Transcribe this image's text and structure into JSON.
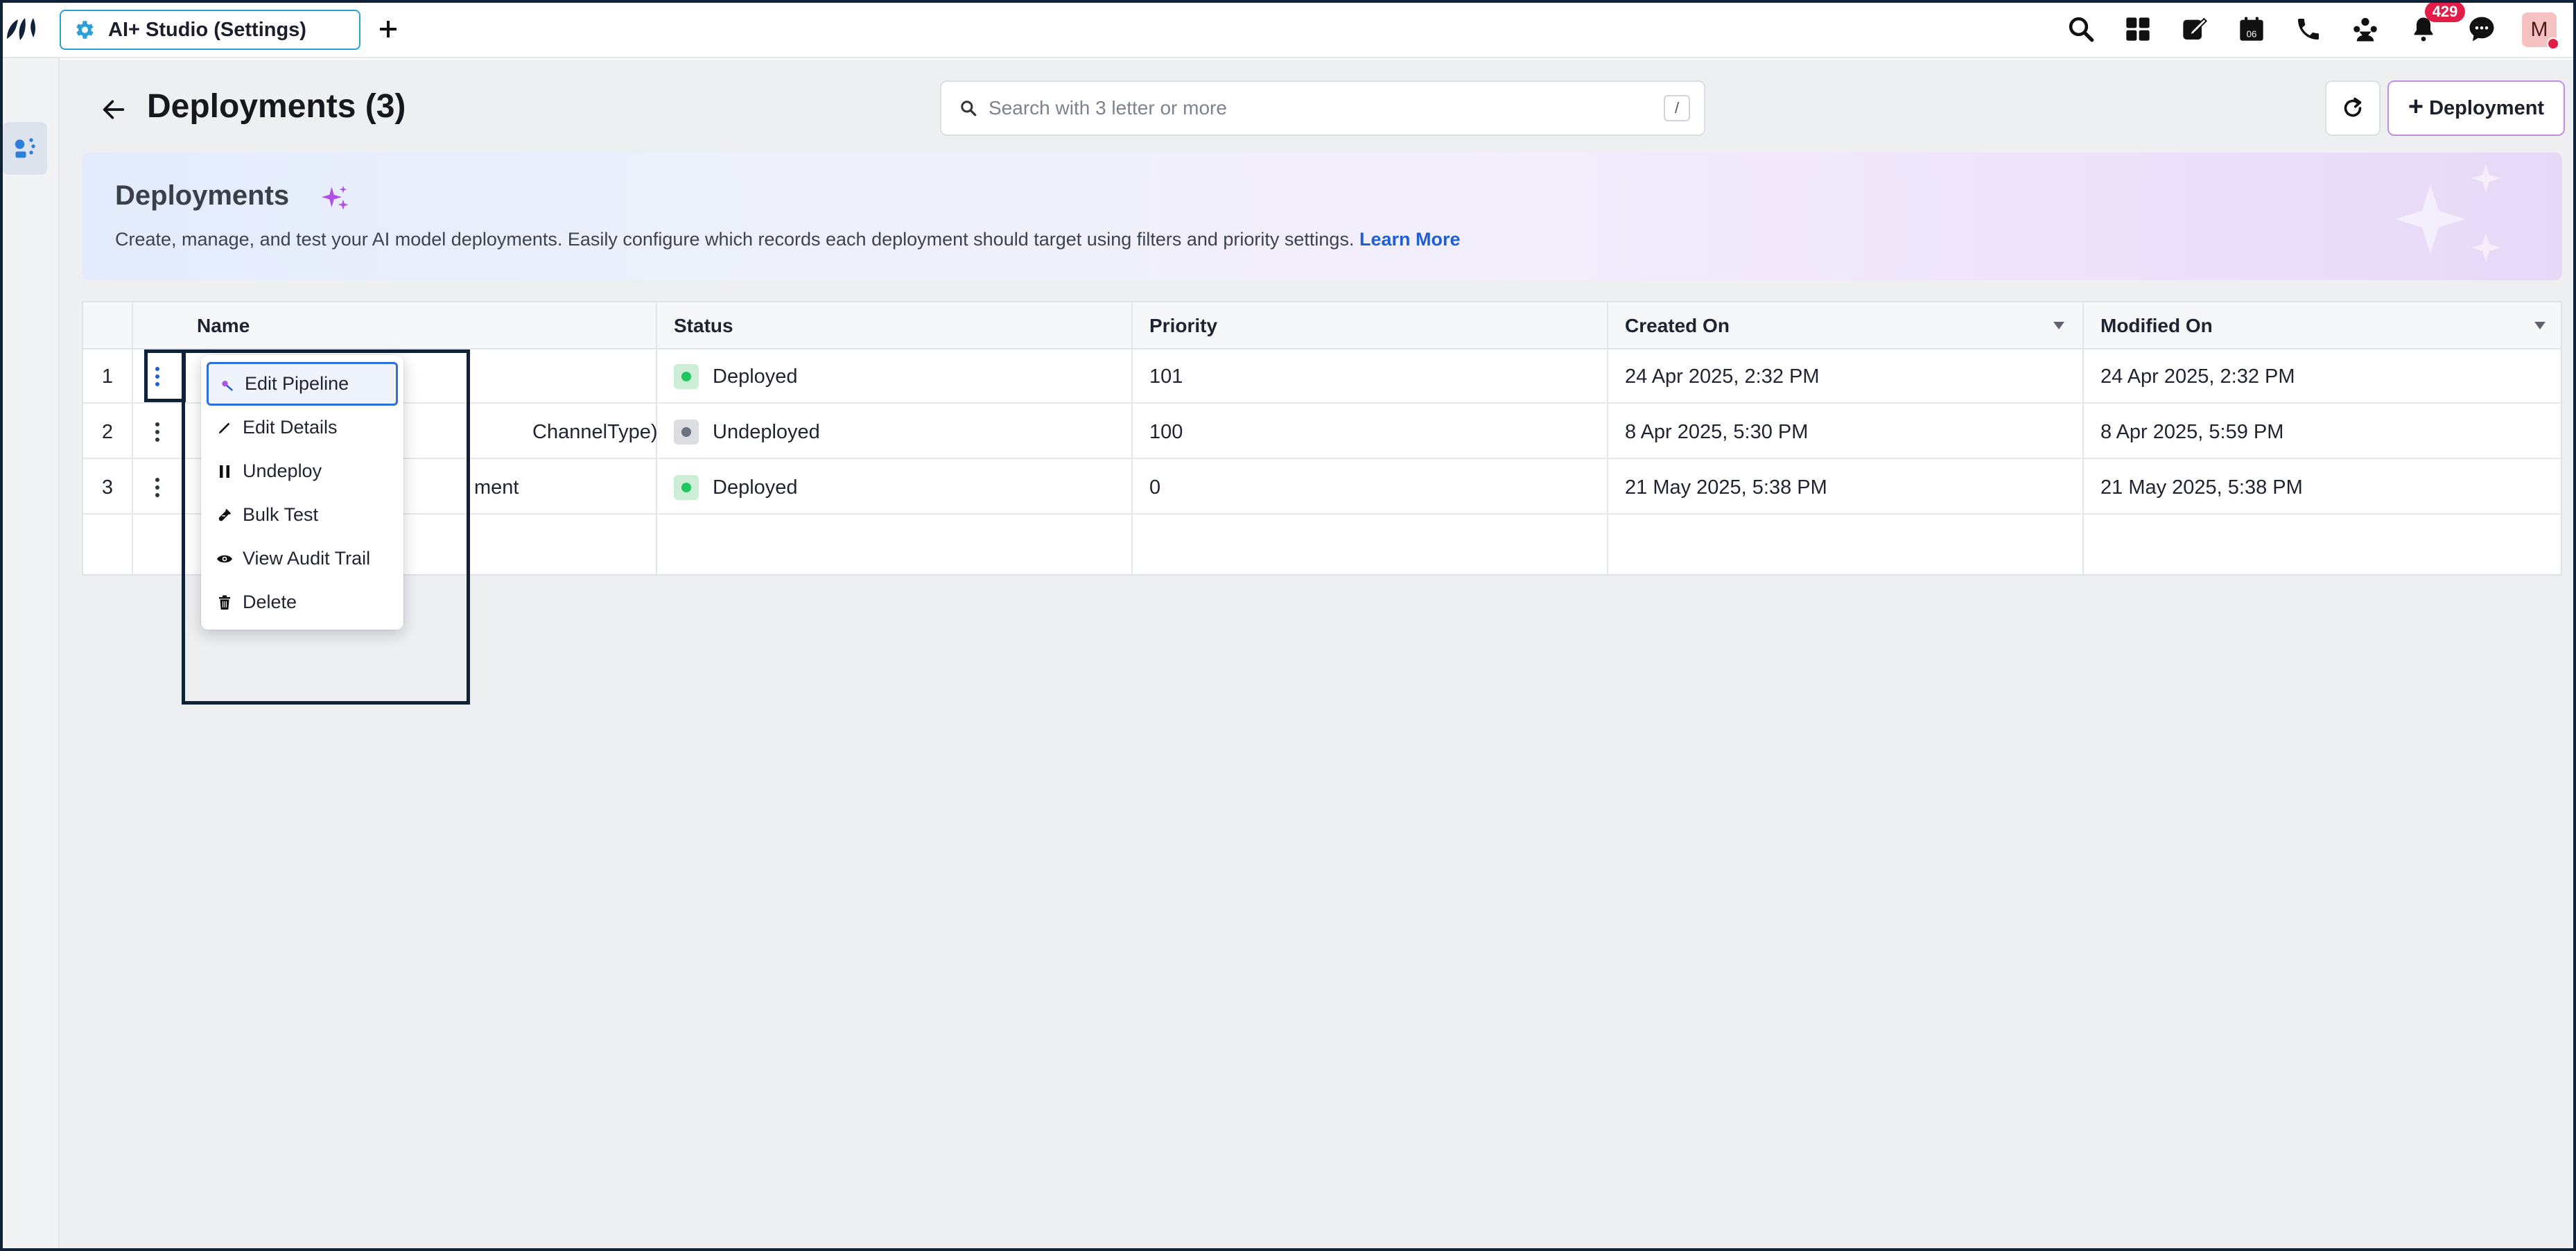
{
  "app_tab": {
    "title": "AI+ Studio (Settings)"
  },
  "topbar": {
    "icons": [
      "search-icon",
      "apps-grid-icon",
      "compose-icon",
      "calendar-icon",
      "phone-icon",
      "community-icon",
      "bell-icon",
      "chat-icon"
    ],
    "calendar_day": "06",
    "notification_count": "429",
    "avatar_initial": "M"
  },
  "header": {
    "title": "Deployments (3)",
    "search_placeholder": "Search with 3 letter or more",
    "search_shortcut": "/",
    "add_button_label": "Deployment"
  },
  "banner": {
    "title": "Deployments",
    "description": "Create, manage, and test your AI model deployments. Easily configure which records each deployment should target using filters and priority settings.",
    "learn_more": "Learn More"
  },
  "table": {
    "columns": [
      "Name",
      "Status",
      "Priority",
      "Created On",
      "Modified On"
    ],
    "rows": [
      {
        "num": "1",
        "name": "",
        "status": "Deployed",
        "status_color": "#22c55e",
        "priority": "101",
        "created": "24 Apr 2025, 2:32 PM",
        "modified": "24 Apr 2025, 2:32 PM"
      },
      {
        "num": "2",
        "name": "ChannelType)",
        "status": "Undeployed",
        "status_color": "#6b7280",
        "priority": "100",
        "created": "8 Apr 2025, 5:30 PM",
        "modified": "8 Apr 2025, 5:59 PM"
      },
      {
        "num": "3",
        "name": "ment",
        "status": "Deployed",
        "status_color": "#22c55e",
        "priority": "0",
        "created": "21 May 2025, 5:38 PM",
        "modified": "21 May 2025, 5:38 PM"
      }
    ]
  },
  "context_menu": {
    "items": [
      {
        "label": "Edit Pipeline",
        "icon": "magic-wand-icon"
      },
      {
        "label": "Edit Details",
        "icon": "pencil-icon"
      },
      {
        "label": "Undeploy",
        "icon": "pause-icon"
      },
      {
        "label": "Bulk Test",
        "icon": "test-tube-icon"
      },
      {
        "label": "View Audit Trail",
        "icon": "eye-icon"
      },
      {
        "label": "Delete",
        "icon": "trash-icon"
      }
    ]
  },
  "colors": {
    "accent": "#2a9fd8",
    "link": "#1f5fd4",
    "deployed": "#22c55e",
    "undeployed": "#6b7280",
    "badge": "#e11d48"
  }
}
